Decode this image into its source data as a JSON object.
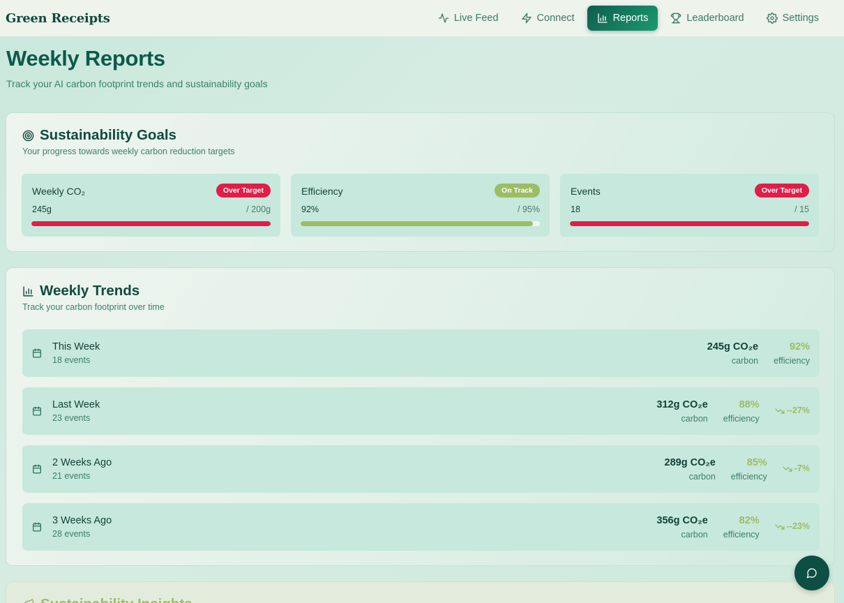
{
  "header": {
    "brand": "Green Receipts",
    "nav": [
      {
        "label": "Live Feed",
        "icon": "activity-icon",
        "active": false
      },
      {
        "label": "Connect",
        "icon": "zap-icon",
        "active": false
      },
      {
        "label": "Reports",
        "icon": "bar-chart-icon",
        "active": true
      },
      {
        "label": "Leaderboard",
        "icon": "trophy-icon",
        "active": false
      },
      {
        "label": "Settings",
        "icon": "gear-icon",
        "active": false
      }
    ]
  },
  "page": {
    "title": "Weekly Reports",
    "subtitle": "Track your AI carbon footprint trends and sustainability goals"
  },
  "goals": {
    "title": "Sustainability Goals",
    "subtitle": "Your progress towards weekly carbon reduction targets",
    "items": [
      {
        "name": "Weekly CO₂",
        "badge": "Over Target",
        "status": "over",
        "value": "245g",
        "target": "/ 200g",
        "progress": 1.0
      },
      {
        "name": "Efficiency",
        "badge": "On Track",
        "status": "on-track",
        "value": "92%",
        "target": "/ 95%",
        "progress": 0.97
      },
      {
        "name": "Events",
        "badge": "Over Target",
        "status": "over",
        "value": "18",
        "target": "/ 15",
        "progress": 1.0
      }
    ]
  },
  "trends": {
    "title": "Weekly Trends",
    "subtitle": "Track your carbon footprint over time",
    "weeks": [
      {
        "name": "This Week",
        "events": "18 events",
        "carbon": "245g CO₂e",
        "carbon_label": "carbon",
        "efficiency": "92%",
        "efficiency_label": "efficiency",
        "change": ""
      },
      {
        "name": "Last Week",
        "events": "23 events",
        "carbon": "312g CO₂e",
        "carbon_label": "carbon",
        "efficiency": "88%",
        "efficiency_label": "efficiency",
        "change": "--27%"
      },
      {
        "name": "2 Weeks Ago",
        "events": "21 events",
        "carbon": "289g CO₂e",
        "carbon_label": "carbon",
        "efficiency": "85%",
        "efficiency_label": "efficiency",
        "change": "-7%"
      },
      {
        "name": "3 Weeks Ago",
        "events": "28 events",
        "carbon": "356g CO₂e",
        "carbon_label": "carbon",
        "efficiency": "82%",
        "efficiency_label": "efficiency",
        "change": "--23%"
      }
    ]
  },
  "insights": {
    "title": "Sustainability Insights"
  },
  "colors": {
    "primary": "#0b5a4b",
    "accent_green": "#9bbd63",
    "alert_red": "#e11d48"
  }
}
